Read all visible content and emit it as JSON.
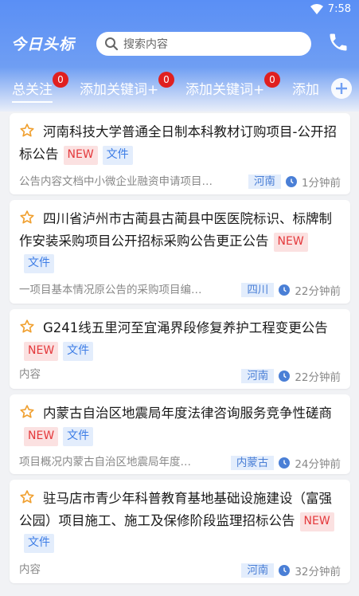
{
  "status_bar": {
    "time": "7:58"
  },
  "header": {
    "app_title": "今日头标",
    "search_placeholder": "搜索内容"
  },
  "tabs": [
    {
      "label": "总关注",
      "badge": "0"
    },
    {
      "label": "添加关键词+",
      "badge": "0"
    },
    {
      "label": "添加关键词+",
      "badge": "0"
    },
    {
      "label": "添加"
    }
  ],
  "tags": {
    "new": "NEW",
    "file": "文件"
  },
  "cards": [
    {
      "title": "河南科技大学普通全日制本科教材订购项目-公开招标公告",
      "summary": "公告内容文档中小微企业融资申请项目…",
      "region": "河南",
      "time": "1分钟前"
    },
    {
      "title": "四川省泸州市古蔺县古蔺县中医医院标识、标牌制作安装采购项目公开招标采购公告更正公告",
      "summary": "一项目基本情况原公告的采购项目编…",
      "region": "四川",
      "time": "22分钟前"
    },
    {
      "title": "G241线五里河至宜渑界段修复养护工程变更公告",
      "summary": "内容",
      "region": "河南",
      "time": "22分钟前"
    },
    {
      "title": "内蒙古自治区地震局年度法律咨询服务竞争性磋商",
      "summary": "项目概况内蒙古自治区地震局年度…",
      "region": "内蒙古",
      "time": "24分钟前"
    },
    {
      "title": "驻马店市青少年科普教育基地基础设施建设（富强公园）项目施工、施工及保修阶段监理招标公告",
      "summary": "内容",
      "region": "河南",
      "time": "32分钟前"
    }
  ],
  "colors": {
    "header_blue": "#5a8ff5",
    "badge_red": "#e02020",
    "new_red": "#e4393c",
    "file_blue": "#3d7de6",
    "star_orange": "#f0a030"
  },
  "icons": [
    "wifi-icon",
    "search-icon",
    "phone-icon",
    "plus-circle-icon",
    "star-outline-icon",
    "clock-icon"
  ]
}
